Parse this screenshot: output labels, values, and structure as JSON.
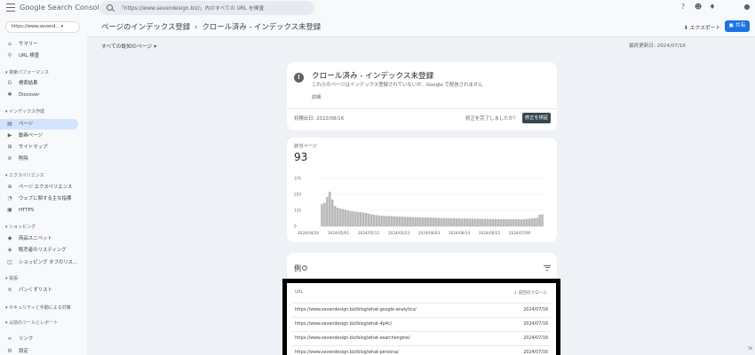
{
  "app": {
    "logo_text": "Google Search Console",
    "search_placeholder": "「https://www.sevendesign.biz/」内のすべての URL を検査"
  },
  "header": {
    "breadcrumb_parent": "ページのインデックス登録",
    "breadcrumb_current": "クロール済み - インデックス未登録",
    "export_label": "エクスポート",
    "share_label": "共有",
    "filter_label": "すべての既知のページ",
    "last_updated": "最終更新日: 2024/07/16"
  },
  "sidebar": {
    "property": "https://www.sevend...",
    "items": [
      {
        "label": "サマリー",
        "icon": "home-icon"
      },
      {
        "label": "URL 検査",
        "icon": "search-icon"
      },
      {
        "section": "検索パフォーマンス"
      },
      {
        "label": "検索結果",
        "icon": "google-g-icon"
      },
      {
        "label": "Discover",
        "icon": "asterisk-icon"
      },
      {
        "section": "インデックス作成"
      },
      {
        "label": "ページ",
        "icon": "pages-icon",
        "active": true
      },
      {
        "label": "動画ページ",
        "icon": "video-icon"
      },
      {
        "label": "サイトマップ",
        "icon": "sitemap-icon"
      },
      {
        "label": "削除",
        "icon": "eye-off-icon"
      },
      {
        "section": "エクスペリエンス"
      },
      {
        "label": "ページ エクスペリエンス",
        "icon": "plus-circle-icon"
      },
      {
        "label": "ウェブに関する主な指標",
        "icon": "gauge-icon"
      },
      {
        "label": "HTTPS",
        "icon": "lock-icon"
      },
      {
        "section": "ショッピング"
      },
      {
        "label": "商品スニペット",
        "icon": "tag-icon"
      },
      {
        "label": "販売者のリスティング",
        "icon": "shield-icon"
      },
      {
        "label": "ショッピング タブのリス...",
        "icon": "cart-icon"
      },
      {
        "section": "拡張"
      },
      {
        "label": "パンくずリスト",
        "icon": "layers-icon"
      },
      {
        "section": "セキュリティと手動による対策"
      },
      {
        "section": "以前のツールとレポート"
      },
      {
        "label": "リンク",
        "icon": "link-icon"
      },
      {
        "label": "設定",
        "icon": "gear-icon"
      }
    ]
  },
  "status_card": {
    "title": "クロール済み - インデックス未登録",
    "subtitle": "これらのページはインデックス登録されていないか、Google で配信されません",
    "details_link": "詳細",
    "first_detected": "初検出日: 2022/08/16",
    "fixed_question": "修正を完了しましたか？",
    "validate_label": "修正を検証"
  },
  "affected_card": {
    "label": "該当ページ",
    "value": "93"
  },
  "chart_data": {
    "type": "bar",
    "ylim": [
      0,
      375
    ],
    "yticks": [
      "375",
      "250",
      "125",
      "0"
    ],
    "xticks": [
      "2024/04/20",
      "2024/05/01",
      "2024/05/12",
      "2024/05/23",
      "2024/06/03",
      "2024/06/14",
      "2024/06/25",
      "2024/07/06"
    ],
    "color": "#b8b8b8",
    "values": [
      175,
      185,
      230,
      270,
      210,
      160,
      145,
      140,
      135,
      130,
      125,
      120,
      118,
      115,
      112,
      110,
      108,
      105,
      100,
      95,
      90,
      88,
      85,
      84,
      82,
      80,
      80,
      79,
      78,
      77,
      76,
      76,
      75,
      74,
      73,
      72,
      72,
      71,
      70,
      70,
      69,
      68,
      68,
      67,
      66,
      66,
      65,
      65,
      64,
      64,
      63,
      63,
      62,
      62,
      61,
      61,
      60,
      60,
      60,
      59,
      59,
      59,
      58,
      58,
      58,
      57,
      57,
      57,
      57,
      56,
      56,
      56,
      56,
      55,
      55,
      55,
      55,
      55,
      56,
      58,
      60,
      62,
      64,
      66,
      90,
      93
    ]
  },
  "examples_card": {
    "title": "例",
    "col_url": "URL",
    "col_crawl": "前回のクロール",
    "rows": [
      {
        "url": "https://www.sevendesign.biz/blog/what-google-analytics/",
        "date": "2024/07/16"
      },
      {
        "url": "https://www.sevendesign.biz/blog/what-4p4c/",
        "date": "2024/07/16"
      },
      {
        "url": "https://www.sevendesign.biz/blog/what-searchengine/",
        "date": "2024/07/16"
      },
      {
        "url": "https://www.sevendesign.biz/blog/what-persona/",
        "date": "2024/07/16"
      }
    ]
  }
}
